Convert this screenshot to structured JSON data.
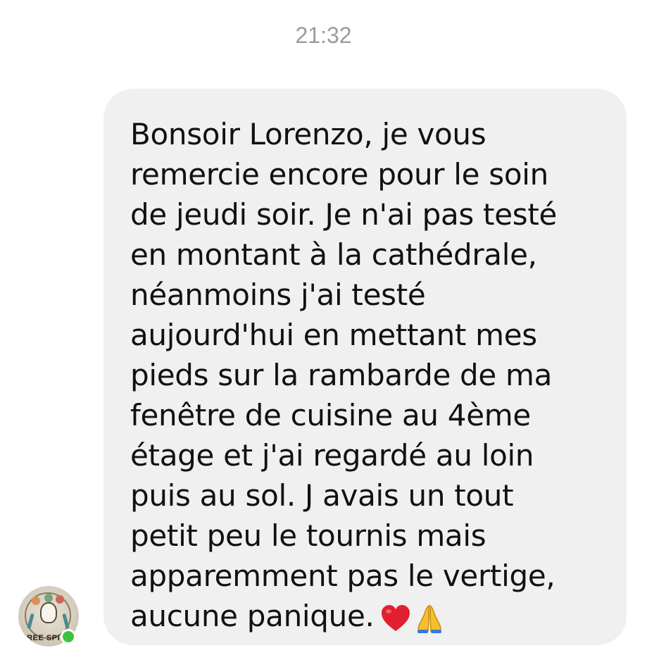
{
  "conversation": {
    "timestamp": "21:32",
    "message": {
      "lines": [
        "Bonsoir Lorenzo, je vous",
        "remercie encore pour le soin",
        "de jeudi soir. Je n'ai pas testé",
        "en montant à la cathédrale,",
        "néanmoins j'ai testé",
        "aujourd'hui en mettant mes",
        "pieds sur la rambarde de ma",
        "fenêtre de cuisine au 4ème",
        "étage et j'ai regardé au loin",
        "puis au sol. J avais un tout",
        "petit peu le tournis mais",
        "apparemment pas le vertige,",
        "aucune panique."
      ],
      "emojis": [
        "heart-emoji",
        "praying-hands-emoji"
      ]
    },
    "sender": {
      "avatar_text": "FREE SPI",
      "online": true,
      "status_color": "#3cc23f"
    }
  },
  "colors": {
    "bubble": "#f0f0f0",
    "timestamp": "#9b9b9b",
    "text": "#111111"
  }
}
